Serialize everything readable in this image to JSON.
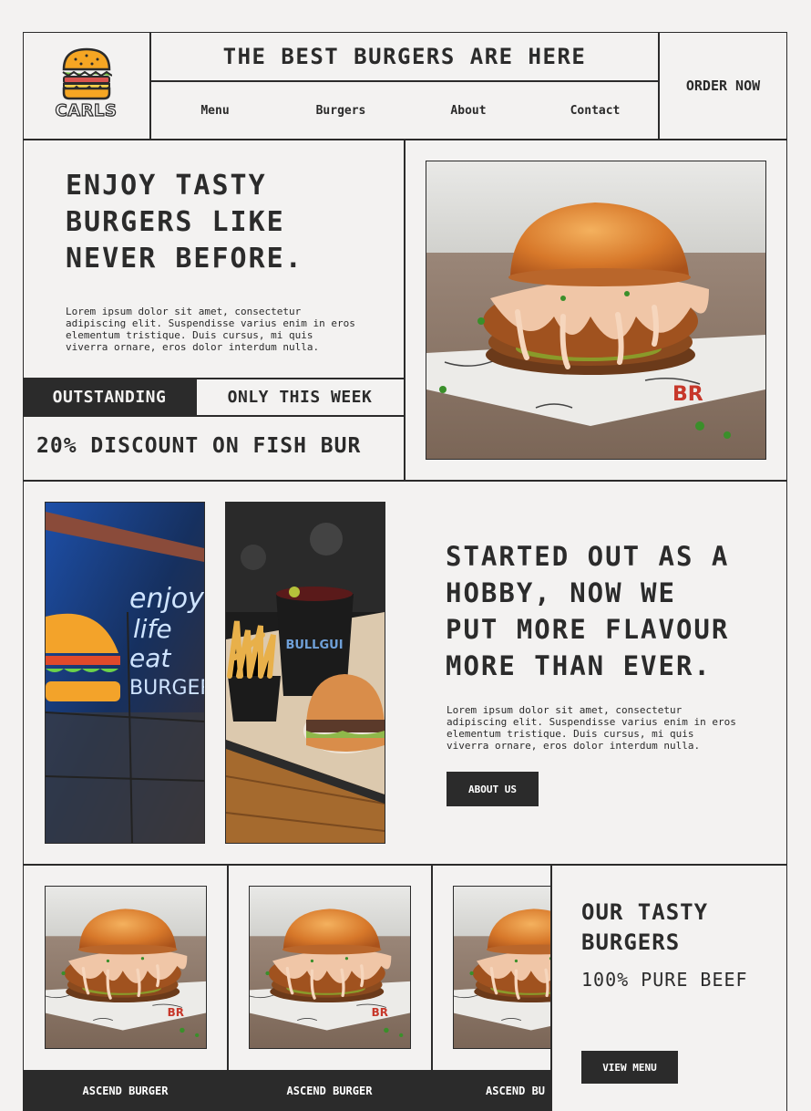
{
  "header": {
    "logo_text": "CARLS",
    "tagline": "THE BEST BURGERS ARE HERE",
    "nav": [
      "Menu",
      "Burgers",
      "About",
      "Contact"
    ],
    "order_label": "ORDER NOW"
  },
  "hero": {
    "heading_lines": [
      "ENJOY TASTY",
      "BURGERS LIKE",
      "NEVER BEFORE."
    ],
    "body_lines": [
      "Lorem ipsum dolor sit amet, consectetur",
      "adipiscing elit. Suspendisse varius enim in eros",
      "elementum tristique. Duis cursus, mi quis",
      "viverra ornare, eros dolor interdum nulla."
    ],
    "badge_dark": "OUTSTANDING",
    "badge_light": "ONLY THIS WEEK",
    "discount_text": "20% DISCOUNT ON FISH BUR"
  },
  "story": {
    "neon_lines": [
      "enjoy",
      "life",
      "eat",
      "BURGER"
    ],
    "cup_brand": "BULLGUI",
    "heading_lines": [
      "STARTED OUT AS A",
      "HOBBY, NOW WE",
      "PUT MORE FLAVOUR",
      "MORE THAN EVER."
    ],
    "body_lines": [
      "Lorem ipsum dolor sit amet, consectetur",
      "adipiscing elit. Suspendisse varius enim in eros",
      "elementum tristique. Duis cursus, mi quis",
      "viverra ornare, eros dolor interdum nulla."
    ],
    "about_label": "ABOUT US"
  },
  "products": {
    "cards": [
      {
        "name": "ASCEND BURGER"
      },
      {
        "name": "ASCEND BURGER"
      },
      {
        "name": "ASCEND BU"
      }
    ],
    "heading_lines": [
      "OUR TASTY",
      "BURGERS"
    ],
    "subheading": "100% PURE BEEF",
    "view_label": "VIEW MENU"
  },
  "colors": {
    "ink": "#2b2b2b",
    "background": "#f3f2f1",
    "bun": "#e0892f"
  }
}
